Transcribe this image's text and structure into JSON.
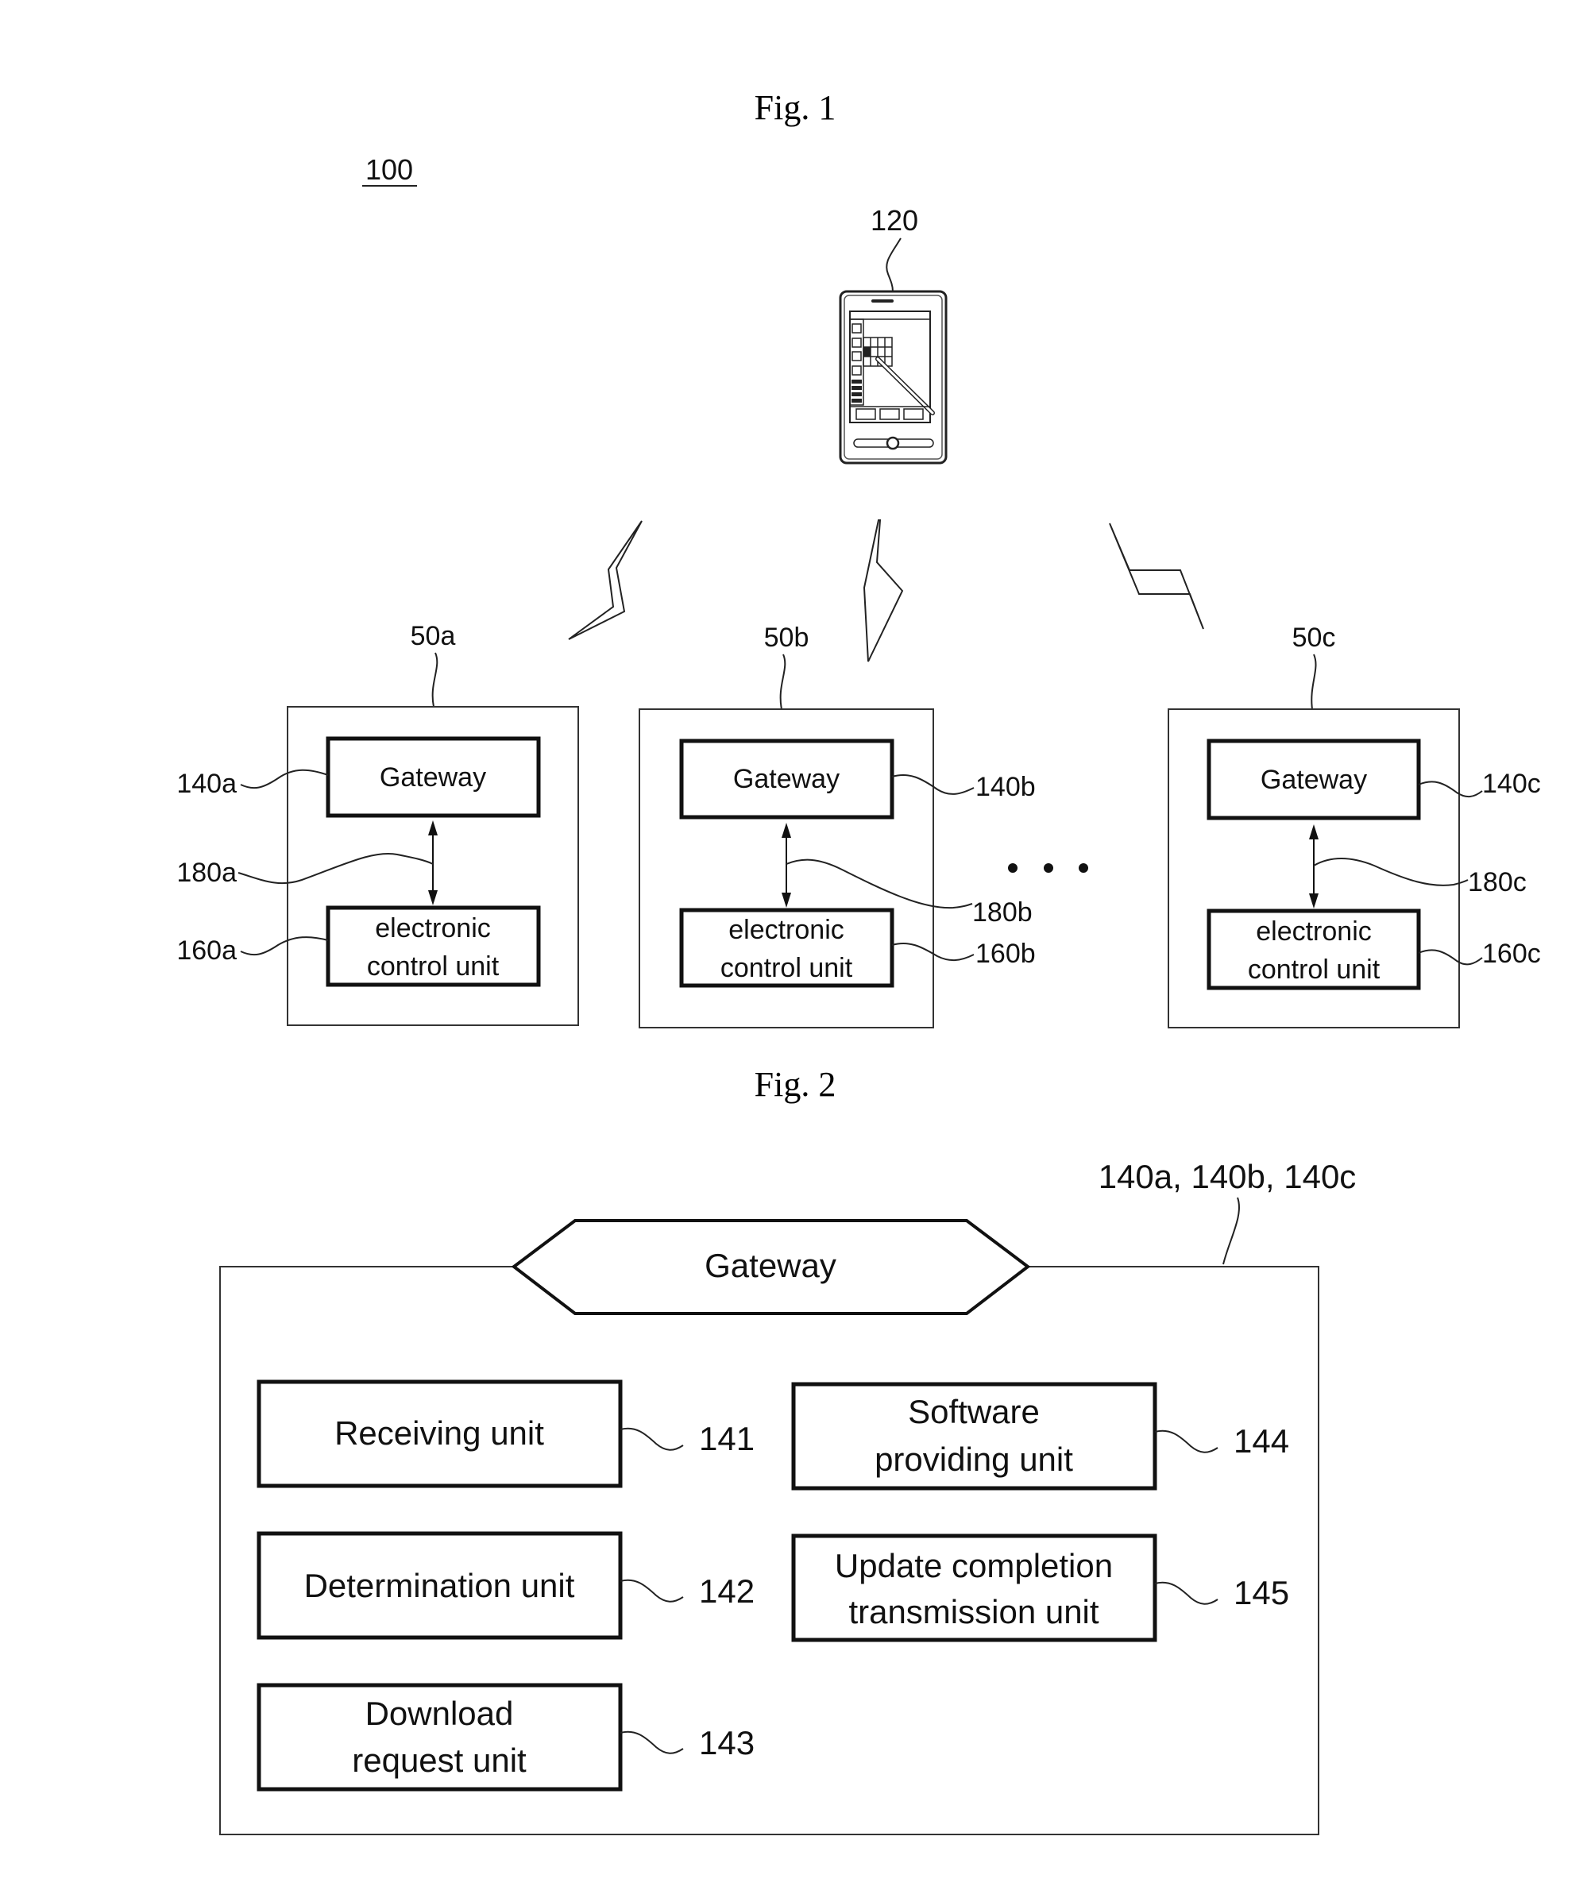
{
  "fig1": {
    "title": "Fig. 1",
    "system_ref": "100",
    "terminal_ref": "120",
    "ellipsis": "• • •",
    "vehicles": [
      {
        "ref": "50a",
        "gateway_label": "Gateway",
        "gateway_ref": "140a",
        "link_ref": "180a",
        "ecu_label_line1": "electronic",
        "ecu_label_line2": "control unit",
        "ecu_ref": "160a"
      },
      {
        "ref": "50b",
        "gateway_label": "Gateway",
        "gateway_ref": "140b",
        "link_ref": "180b",
        "ecu_label_line1": "electronic",
        "ecu_label_line2": "control unit",
        "ecu_ref": "160b"
      },
      {
        "ref": "50c",
        "gateway_label": "Gateway",
        "gateway_ref": "140c",
        "link_ref": "180c",
        "ecu_label_line1": "electronic",
        "ecu_label_line2": "control unit",
        "ecu_ref": "160c"
      }
    ]
  },
  "fig2": {
    "title": "Fig. 2",
    "gateway_refs": "140a, 140b, 140c",
    "gateway_label": "Gateway",
    "units": [
      {
        "line1": "Receiving unit",
        "line2": "",
        "ref": "141"
      },
      {
        "line1": "Determination unit",
        "line2": "",
        "ref": "142"
      },
      {
        "line1": "Download",
        "line2": "request unit",
        "ref": "143"
      },
      {
        "line1": "Software",
        "line2": "providing unit",
        "ref": "144"
      },
      {
        "line1": "Update completion",
        "line2": "transmission unit",
        "ref": "145"
      }
    ]
  }
}
